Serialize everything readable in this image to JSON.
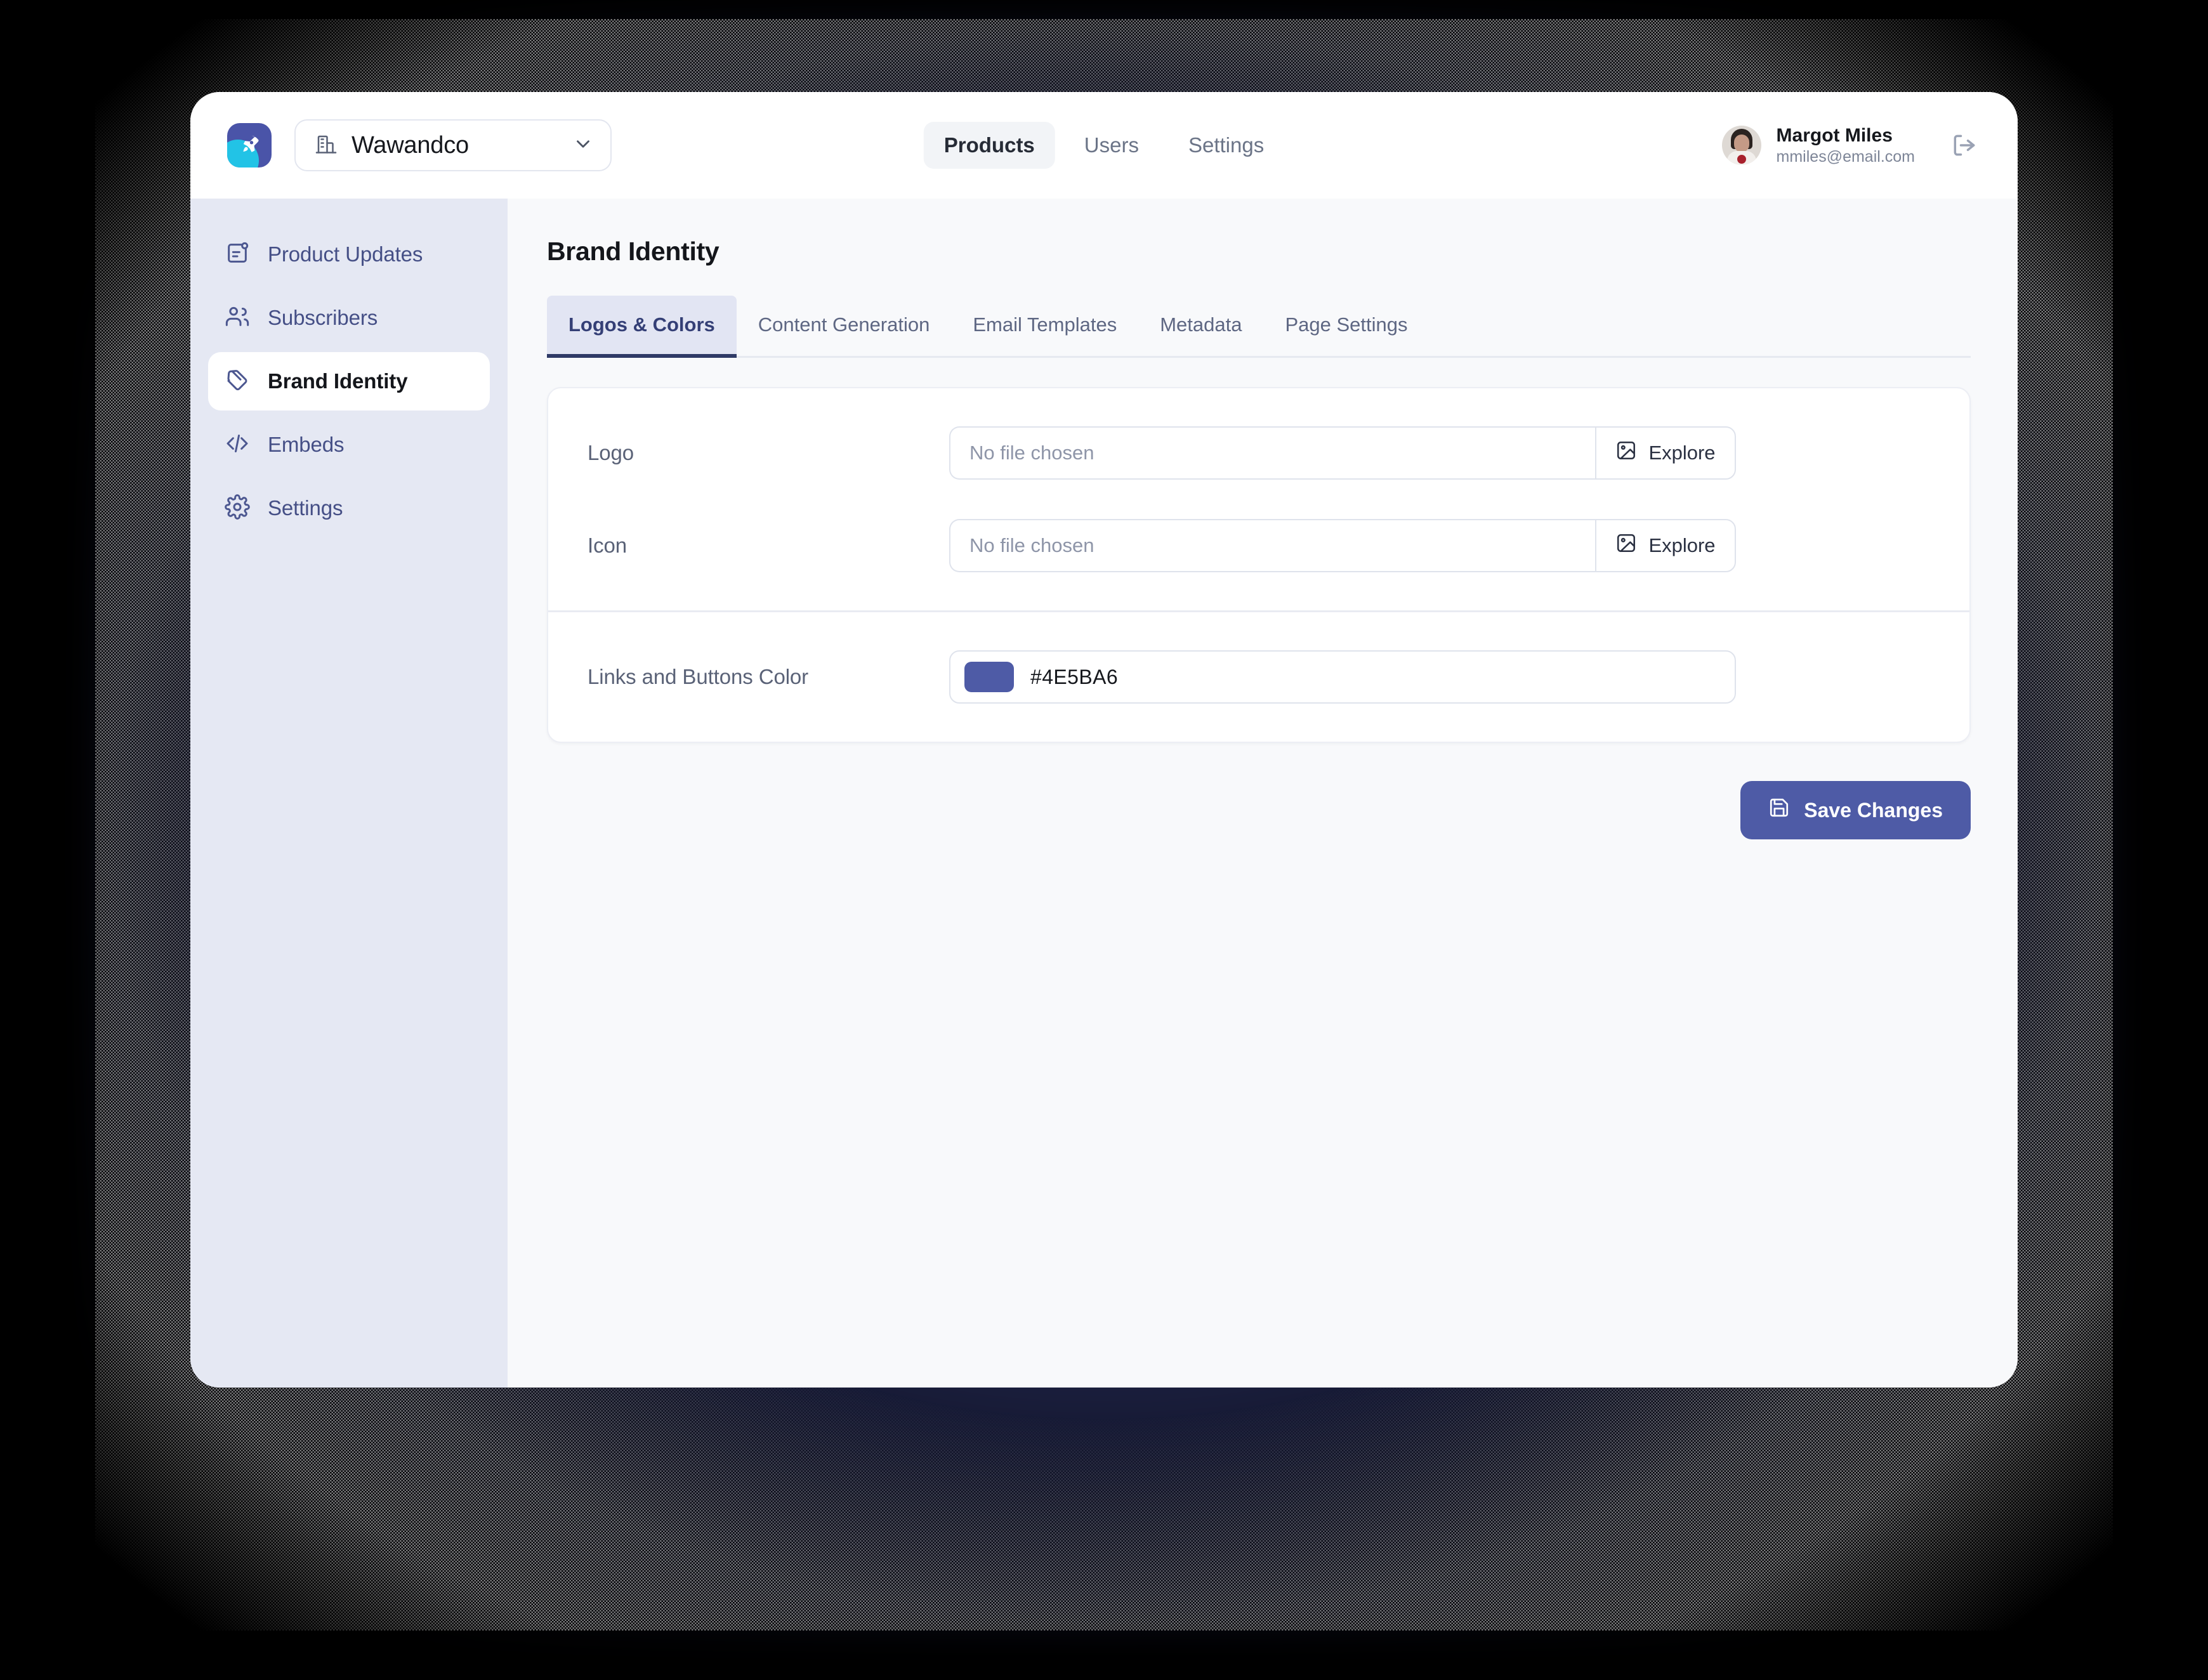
{
  "app": {
    "logo_icon": "rocket-icon",
    "brand_color": "#4a54a8",
    "brand_accent": "#22c3e6"
  },
  "org_switcher": {
    "icon": "building-icon",
    "value": "Wawandco",
    "chevron": "chevron-down-icon"
  },
  "topnav": {
    "items": [
      {
        "label": "Products",
        "active": true
      },
      {
        "label": "Users",
        "active": false
      },
      {
        "label": "Settings",
        "active": false
      }
    ]
  },
  "user": {
    "name": "Margot Miles",
    "email": "mmiles@email.com",
    "avatar_icon": "avatar",
    "logout_icon": "logout-icon"
  },
  "sidebar": {
    "items": [
      {
        "label": "Product Updates",
        "icon": "product-updates-icon",
        "active": false
      },
      {
        "label": "Subscribers",
        "icon": "subscribers-icon",
        "active": false
      },
      {
        "label": "Brand Identity",
        "icon": "tag-icon",
        "active": true
      },
      {
        "label": "Embeds",
        "icon": "code-icon",
        "active": false
      },
      {
        "label": "Settings",
        "icon": "gear-icon",
        "active": false
      }
    ]
  },
  "page": {
    "title": "Brand Identity",
    "tabs": [
      {
        "label": "Logos & Colors",
        "active": true
      },
      {
        "label": "Content Generation",
        "active": false
      },
      {
        "label": "Email Templates",
        "active": false
      },
      {
        "label": "Metadata",
        "active": false
      },
      {
        "label": "Page Settings",
        "active": false
      }
    ]
  },
  "form": {
    "logo": {
      "label": "Logo",
      "file_value": "No file chosen",
      "button_label": "Explore",
      "button_icon": "image-icon"
    },
    "icon": {
      "label": "Icon",
      "file_value": "No file chosen",
      "button_label": "Explore",
      "button_icon": "image-icon"
    },
    "color": {
      "label": "Links and Buttons Color",
      "value": "#4E5BA6",
      "swatch_color": "#4e5ba6"
    },
    "save": {
      "label": "Save Changes",
      "icon": "save-icon",
      "color": "#4e5ba6"
    }
  }
}
